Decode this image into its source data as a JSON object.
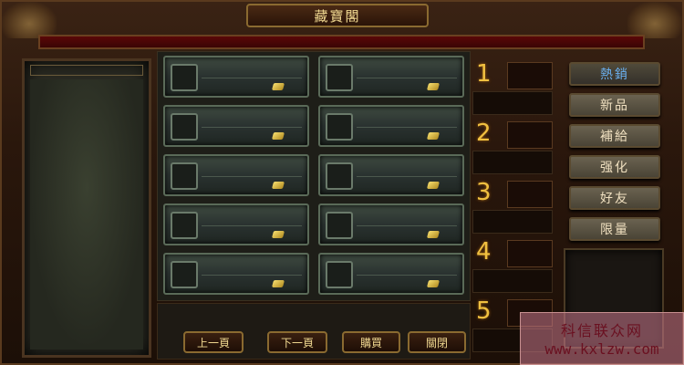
{
  "window": {
    "title": "藏寶閣"
  },
  "slots": [
    {
      "id": 1
    },
    {
      "id": 2
    },
    {
      "id": 3
    },
    {
      "id": 4
    },
    {
      "id": 5
    },
    {
      "id": 6
    },
    {
      "id": 7
    },
    {
      "id": 8
    },
    {
      "id": 9
    },
    {
      "id": 10
    }
  ],
  "buttons": {
    "prev": "上一頁",
    "next": "下一頁",
    "buy": "購買",
    "close": "關閉"
  },
  "ranking": [
    "1",
    "2",
    "3",
    "4",
    "5"
  ],
  "tabs": [
    {
      "label": "熱銷",
      "active": true
    },
    {
      "label": "新品",
      "active": false
    },
    {
      "label": "補給",
      "active": false
    },
    {
      "label": "强化",
      "active": false
    },
    {
      "label": "好友",
      "active": false
    },
    {
      "label": "限量",
      "active": false
    }
  ],
  "watermark": {
    "line1": "科信联众网",
    "line2": "www.kxlzw.com"
  },
  "colors": {
    "accent_gold": "#f0d890",
    "active_tab": "#6ab0f0",
    "rank_number": "#f0c040"
  }
}
